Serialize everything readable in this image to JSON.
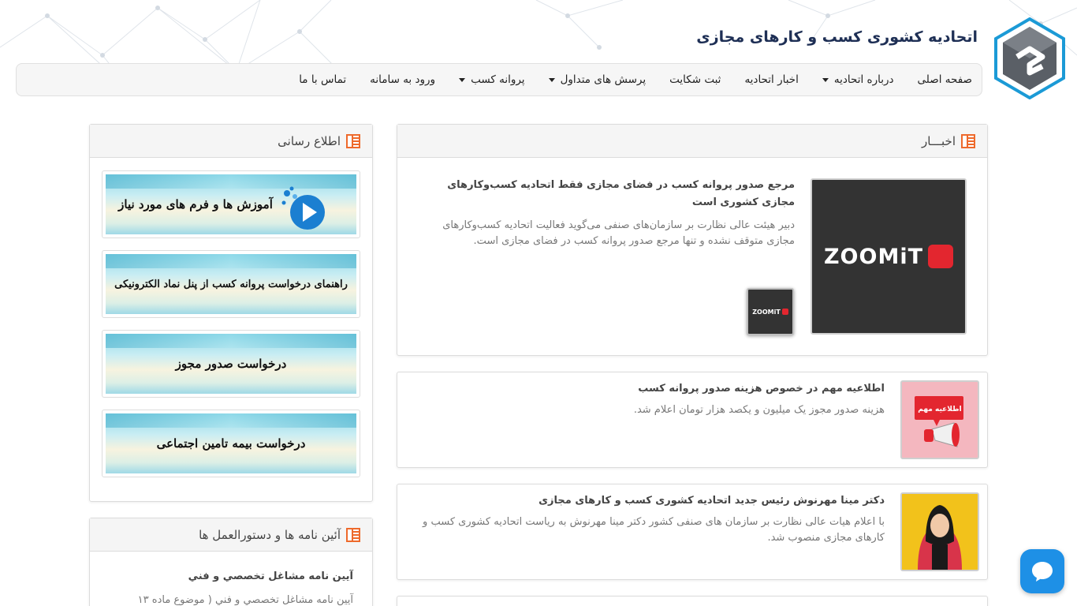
{
  "header": {
    "site_title": "اتحادیه کشوری کسب و کارهای مجازی"
  },
  "nav": {
    "items": [
      {
        "label": "صفحه اصلی",
        "dropdown": false
      },
      {
        "label": "درباره اتحادیه",
        "dropdown": true
      },
      {
        "label": "اخبار اتحادیه",
        "dropdown": false
      },
      {
        "label": "ثبت شکایت",
        "dropdown": false
      },
      {
        "label": "پرسش های متداول",
        "dropdown": true
      },
      {
        "label": "پروانه کسب",
        "dropdown": true
      },
      {
        "label": "ورود به سامانه",
        "dropdown": false
      },
      {
        "label": "تماس با ما",
        "dropdown": false
      }
    ]
  },
  "news": {
    "heading": "اخبـــار",
    "featured": {
      "title": "مرجع صدور پروانه کسب در فضای مجازی فقط اتحادیه کسب‌وکارهای مجازی کشوری است",
      "body": "دبیر هیئت عالی نظارت بر سازمان‌های صنفی می‌گوید فعالیت اتحادیه کسب‌وکارهای مجازی متوقف نشده و تنها مرجع صدور پروانه کسب در فضای مجازی است.",
      "image_logo_text": "ZOOMiT"
    },
    "items": [
      {
        "title": "اطلاعیه مهم در خصوص هزینه صدور پروانه کسب",
        "body": "هزینه صدور مجوز یک میلیون و یکصد هزار تومان اعلام شد.",
        "image_badge": "اطلاعیه مهم"
      },
      {
        "title": "دکتر مینا مهرنوش رئیس جدید اتحادیه کشوری کسب و کارهای مجازی",
        "body": "با اعلام هیات عالی نظارت بر سازمان های صنفی کشور دکتر مینا مهرنوش به ریاست اتحادیه کشوری کسب و کارهای مجازی منصوب شد."
      }
    ]
  },
  "info": {
    "heading": "اطلاع رسانی",
    "banners": [
      "آموزش ها و فرم های مورد نیاز",
      "راهنمای درخواست پروانه کسب از پنل نماد الکترونیکی",
      "درخواست صدور مجوز",
      "درخواست بیمه تامین اجتماعی"
    ]
  },
  "rules": {
    "heading": "آئین نامه ها و دستورالعمل ها",
    "item_title": "آيين نامه مشاغل تخصصي و فني",
    "item_body": "آيين نامه مشاغل تخصصي و فني ( موضوع ماده ۱۳"
  },
  "colors": {
    "title_blue": "#1e2f55",
    "logo_blue": "#1b9ad6",
    "chat_blue": "#1e90e6",
    "icon_orange": "#ee6a2c"
  }
}
